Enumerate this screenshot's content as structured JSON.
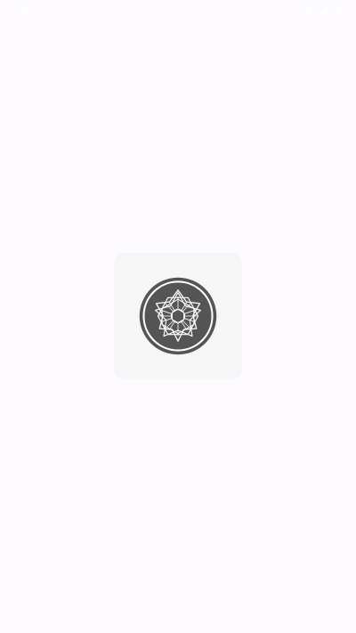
{
  "status_bar": {
    "time": "7:11",
    "indicator": "",
    "icons": [
      "wifi-icon",
      "signal-icon",
      "battery-icon"
    ]
  },
  "splash": {
    "logo_icon": "geometric-mandala-logo-icon",
    "card_color": "#f6f6f6",
    "logo_circle_color": "#555555",
    "logo_line_color": "#ffffff"
  }
}
